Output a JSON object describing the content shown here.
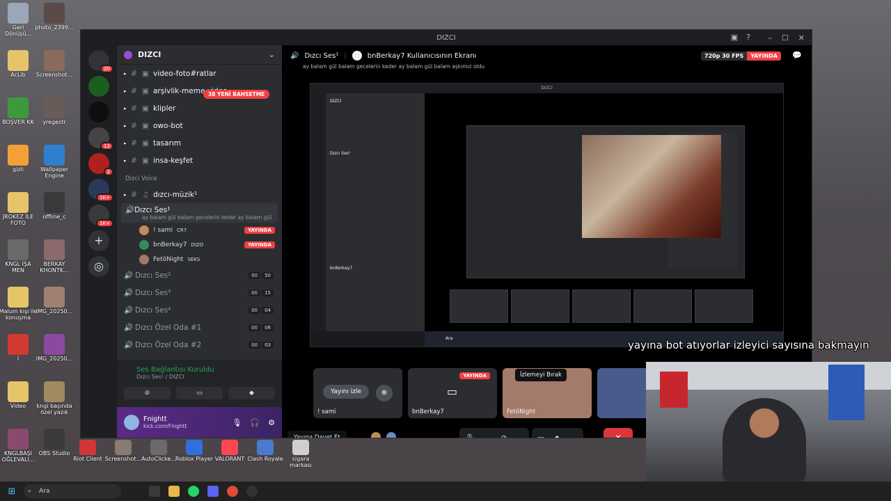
{
  "window": {
    "title": "DIZCI"
  },
  "desktop_icons": [
    {
      "label": "Geri Dönüşü...",
      "color": "#9aa7b8"
    },
    {
      "label": "photo_2399...",
      "color": "#5a4a48"
    },
    {
      "label": "AcLib",
      "color": "#e6c46a"
    },
    {
      "label": "Screenshot...",
      "color": "#8c6a5c"
    },
    {
      "label": "BOŞVER KK",
      "color": "#3c9a3c"
    },
    {
      "label": "yregestr",
      "color": "#6a5a58"
    },
    {
      "label": "gizli",
      "color": "#f4a03a"
    },
    {
      "label": "Wallpaper Engine",
      "color": "#2f7fd0"
    },
    {
      "label": "JROKEZ İLE FOTO",
      "color": "#e6c46a"
    },
    {
      "label": "offline_c",
      "color": "#3a3a3a"
    },
    {
      "label": "KNGL İŞA MEN",
      "color": "#6a6a6a"
    },
    {
      "label": "BERKAY KHONTK...",
      "color": "#8a6a6a"
    },
    {
      "label": "Malum kişi ile konuşma",
      "color": "#e6c46a"
    },
    {
      "label": "IMG_20250...",
      "color": "#a08070"
    },
    {
      "label": "İ",
      "color": "#d33a2f"
    },
    {
      "label": "IMG_20250...",
      "color": "#8a4aa0"
    },
    {
      "label": "Video",
      "color": "#e6c46a"
    },
    {
      "label": "kngi başında özel yazık",
      "color": "#a08a60"
    },
    {
      "label": "KNGLBAŞI OĞLEVALI...",
      "color": "#8a4a70"
    },
    {
      "label": "OBS Studio",
      "color": "#3a3a3a"
    }
  ],
  "bottom_apps": [
    {
      "label": "Riot Client",
      "color": "#d13639"
    },
    {
      "label": "Screenshot...",
      "color": "#8a7a70"
    },
    {
      "label": "AutoClicke...",
      "color": "#6a6a6a"
    },
    {
      "label": "Roblox Player",
      "color": "#2f6fe0"
    },
    {
      "label": "VALORANT",
      "color": "#ff4655"
    },
    {
      "label": "Clash Royale",
      "color": "#4a7ad0"
    },
    {
      "label": "sigara markası",
      "color": "#cfcfcf"
    }
  ],
  "servers": [
    {
      "badge": "20"
    },
    {
      "badge": ""
    },
    {
      "badge": ""
    },
    {
      "badge": "13"
    },
    {
      "badge": "2"
    },
    {
      "badge": "1K+"
    },
    {
      "badge": "1K+"
    }
  ],
  "guild": {
    "name": "DIZCI",
    "new_mentions": "38 YENİ BAHSETME"
  },
  "text_channels": [
    {
      "name": "video-foto#ratlar"
    },
    {
      "name": "arşivlik-meme-video"
    },
    {
      "name": "klipler"
    },
    {
      "name": "owo-bot"
    },
    {
      "name": "tasarım"
    },
    {
      "name": "insa-keşfet"
    }
  ],
  "voice_category": "Dizci Voice",
  "music_channel": "dızcı-müzik¹",
  "active_voice": {
    "name": "Dızcı Ses¹",
    "status": "ay balam gül balam gecelerin keder ay balam gül bala..."
  },
  "voice_users": [
    {
      "name": "! sami",
      "tag": "CR7",
      "live": "YAYINDA",
      "color": "#c08a5a"
    },
    {
      "name": "bnBerkay7",
      "tag": "DIZO",
      "live": "YAYINDA",
      "color": "#2f8f5a"
    },
    {
      "name": "FetöNight",
      "tag": "SEKS",
      "live": "",
      "color": "#a07a6a"
    }
  ],
  "other_voice": [
    {
      "name": "Dızcı Ses²",
      "a": "00",
      "b": "50"
    },
    {
      "name": "Dızcı Ses³",
      "a": "00",
      "b": "15"
    },
    {
      "name": "Dızcı Ses⁴",
      "a": "00",
      "b": "04"
    },
    {
      "name": "Dızcı Özel Oda #1",
      "a": "00",
      "b": "06"
    },
    {
      "name": "Dızcı Özel Oda #2",
      "a": "00",
      "b": "03"
    }
  ],
  "connection": {
    "status": "Ses Bağlantısı Kuruldu",
    "where": "Dızcı Ses¹ / DIZCI"
  },
  "me": {
    "name": "Fnightt",
    "sub": "kick.com/Fnightt"
  },
  "stage": {
    "channel": "Dızcı Ses¹",
    "screen_title": "bnBerkay7 Kullanıcısının Ekranı",
    "status": "ay balam gül balam gecelerin keder ay balam gül balam aşkımız oldu",
    "quality": "720p 30 FPS",
    "live": "YAYINDA"
  },
  "inner": {
    "title": "DIZCI",
    "taskbar_search": "Ara",
    "sharer": "bnBerkay7"
  },
  "tiles": [
    {
      "label": "! sami",
      "watch": "Yayını izle",
      "live": ""
    },
    {
      "label": "bnBerkay7",
      "watch": "",
      "live": "YAYINDA"
    },
    {
      "label": "FetöNight",
      "watch": "",
      "live": ""
    },
    {
      "label": "",
      "watch": "",
      "live": ""
    }
  ],
  "invite_label": "Yayına Davet Et",
  "tooltip": "İzlemeyi Bırak",
  "overlay_text": "yayına bot atıyorlar izleyici sayısına bakmayın",
  "taskbar": {
    "search": "Ara"
  }
}
